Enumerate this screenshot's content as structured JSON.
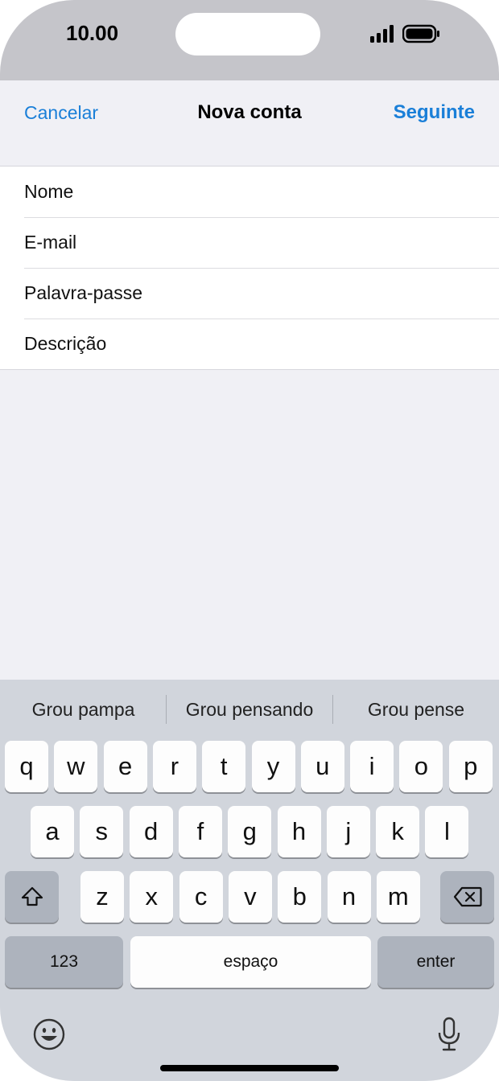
{
  "status": {
    "time": "10.00"
  },
  "nav": {
    "cancel": "Cancelar",
    "title": "Nova conta",
    "next": "Seguinte"
  },
  "form": {
    "fields": [
      {
        "label": "Nome"
      },
      {
        "label": "E-mail"
      },
      {
        "label": "Palavra-passe"
      },
      {
        "label": "Descrição"
      }
    ]
  },
  "keyboard": {
    "suggestions": [
      "Grou pampa",
      "Grou pensando",
      "Grou pense"
    ],
    "row1": [
      "q",
      "w",
      "e",
      "r",
      "t",
      "y",
      "u",
      "i",
      "o",
      "p"
    ],
    "row2": [
      "a",
      "s",
      "d",
      "f",
      "g",
      "h",
      "j",
      "k",
      "l"
    ],
    "row3": [
      "z",
      "x",
      "c",
      "v",
      "b",
      "n",
      "m"
    ],
    "numbers": "123",
    "space": "espaço",
    "enter": "enter"
  },
  "icons": {
    "shift": "shift-icon",
    "delete": "backspace-icon",
    "emoji": "emoji-icon",
    "mic": "microphone-icon"
  },
  "colors": {
    "accent": "#1a7fd8"
  }
}
